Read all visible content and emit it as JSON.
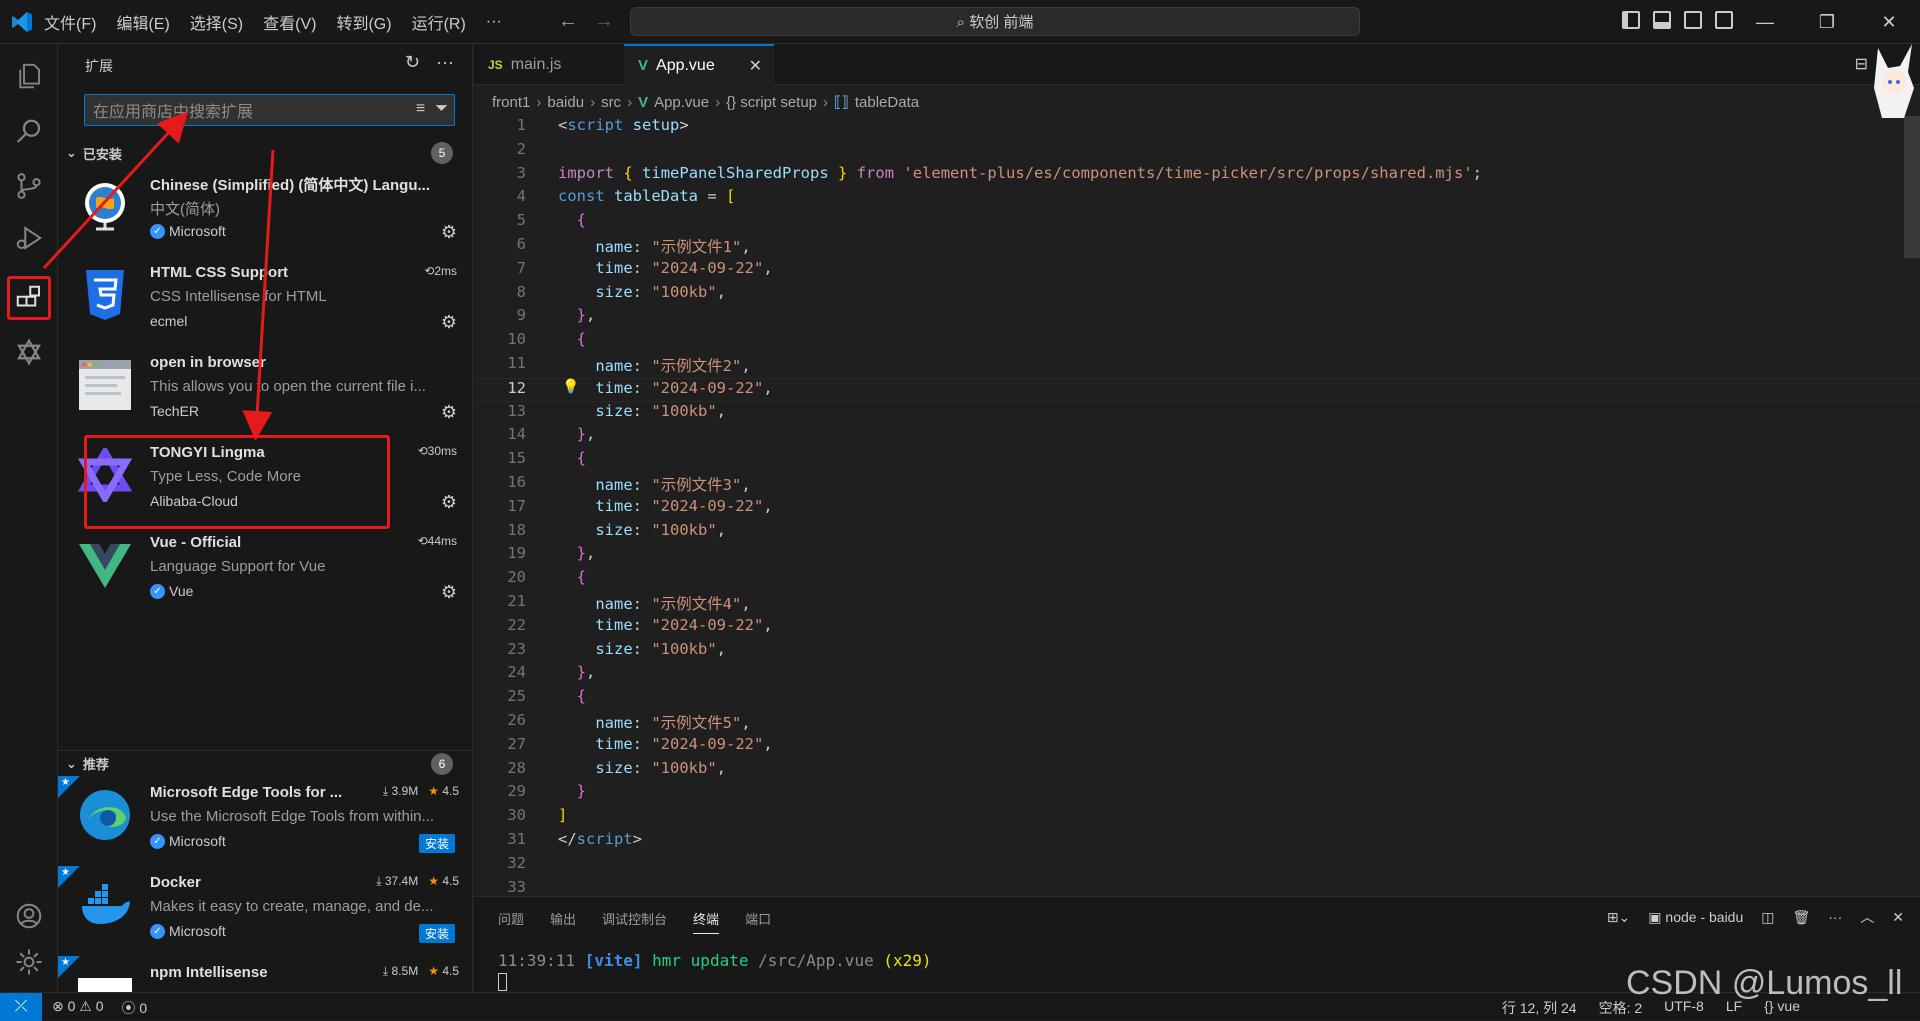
{
  "menu": [
    "文件(F)",
    "编辑(E)",
    "选择(S)",
    "查看(V)",
    "转到(G)",
    "运行(R)",
    "···"
  ],
  "command_center": "⌕ 软创 前端",
  "sidebar": {
    "title": "扩展",
    "search_placeholder": "在应用商店中搜索扩展",
    "installed_label": "已安装",
    "installed_count": "5",
    "recommended_label": "推荐",
    "recommended_count": "6",
    "installed": [
      {
        "name": "Chinese (Simplified) (简体中文) Langu...",
        "desc": "中文(简体)",
        "publisher": "Microsoft",
        "time": ""
      },
      {
        "name": "HTML CSS Support",
        "desc": "CSS Intellisense for HTML",
        "publisher": "ecmel",
        "time": "2ms"
      },
      {
        "name": "open in browser",
        "desc": "This allows you to open the current file i...",
        "publisher": "TechER",
        "time": ""
      },
      {
        "name": "TONGYI Lingma",
        "desc": "Type Less, Code More",
        "publisher": "Alibaba-Cloud",
        "time": "30ms"
      },
      {
        "name": "Vue - Official",
        "desc": "Language Support for Vue",
        "publisher": "Vue",
        "time": "44ms"
      }
    ],
    "recommended": [
      {
        "name": "Microsoft Edge Tools for ...",
        "desc": "Use the Microsoft Edge Tools from within...",
        "publisher": "Microsoft",
        "downloads": "3.9M",
        "rating": "4.5",
        "install": "安装"
      },
      {
        "name": "Docker",
        "desc": "Makes it easy to create, manage, and de...",
        "publisher": "Microsoft",
        "downloads": "37.4M",
        "rating": "4.5",
        "install": "安装"
      },
      {
        "name": "npm Intellisense",
        "desc": "",
        "publisher": "",
        "downloads": "8.5M",
        "rating": "4.5",
        "install": ""
      }
    ]
  },
  "tabs": [
    {
      "label": "main.js",
      "icon": "JS"
    },
    {
      "label": "App.vue",
      "icon": "V",
      "close": "✕"
    }
  ],
  "breadcrumb": [
    "front1",
    "baidu",
    "src",
    "App.vue",
    "{} script setup",
    "tableData"
  ],
  "editor": {
    "active_line": 12,
    "line_numbers": [
      "1",
      "2",
      "3",
      "4",
      "5",
      "6",
      "7",
      "8",
      "9",
      "10",
      "11",
      "12",
      "13",
      "14",
      "15",
      "16",
      "17",
      "18",
      "19",
      "20",
      "21",
      "22",
      "23",
      "24",
      "25",
      "26",
      "27",
      "28",
      "29",
      "30",
      "31",
      "32",
      "33"
    ],
    "import_path": "'element-plus/es/components/time-picker/src/props/shared.mjs'",
    "rows": [
      {
        "name": "\"示例文件1\"",
        "time": "\"2024-09-22\"",
        "size": "\"100kb\""
      },
      {
        "name": "\"示例文件2\"",
        "time": "\"2024-09-22\"",
        "size": "\"100kb\""
      },
      {
        "name": "\"示例文件3\"",
        "time": "\"2024-09-22\"",
        "size": "\"100kb\""
      },
      {
        "name": "\"示例文件4\"",
        "time": "\"2024-09-22\"",
        "size": "\"100kb\""
      },
      {
        "name": "\"示例文件5\"",
        "time": "\"2024-09-22\"",
        "size": "\"100kb\""
      }
    ]
  },
  "panel": {
    "tabs": [
      "问题",
      "输出",
      "调试控制台",
      "终端",
      "端口"
    ],
    "active_tab": "终端",
    "terminal_name": "node - baidu",
    "log_time": "11:39:11",
    "log_tag": "[vite]",
    "log_msg": "hmr update",
    "log_path": "/src/App.vue",
    "log_count": "(x29)"
  },
  "status": {
    "errors": "⊗ 0 ⚠ 0",
    "ports": "⦿ 0",
    "position": "行 12, 列 24",
    "spaces": "空格: 2",
    "encoding": "UTF-8",
    "eol": "LF",
    "lang": "{} vue"
  },
  "watermark": "CSDN @Lumos_ll",
  "colors": {
    "accent": "#0078d4",
    "highlight": "#e51a1a"
  }
}
